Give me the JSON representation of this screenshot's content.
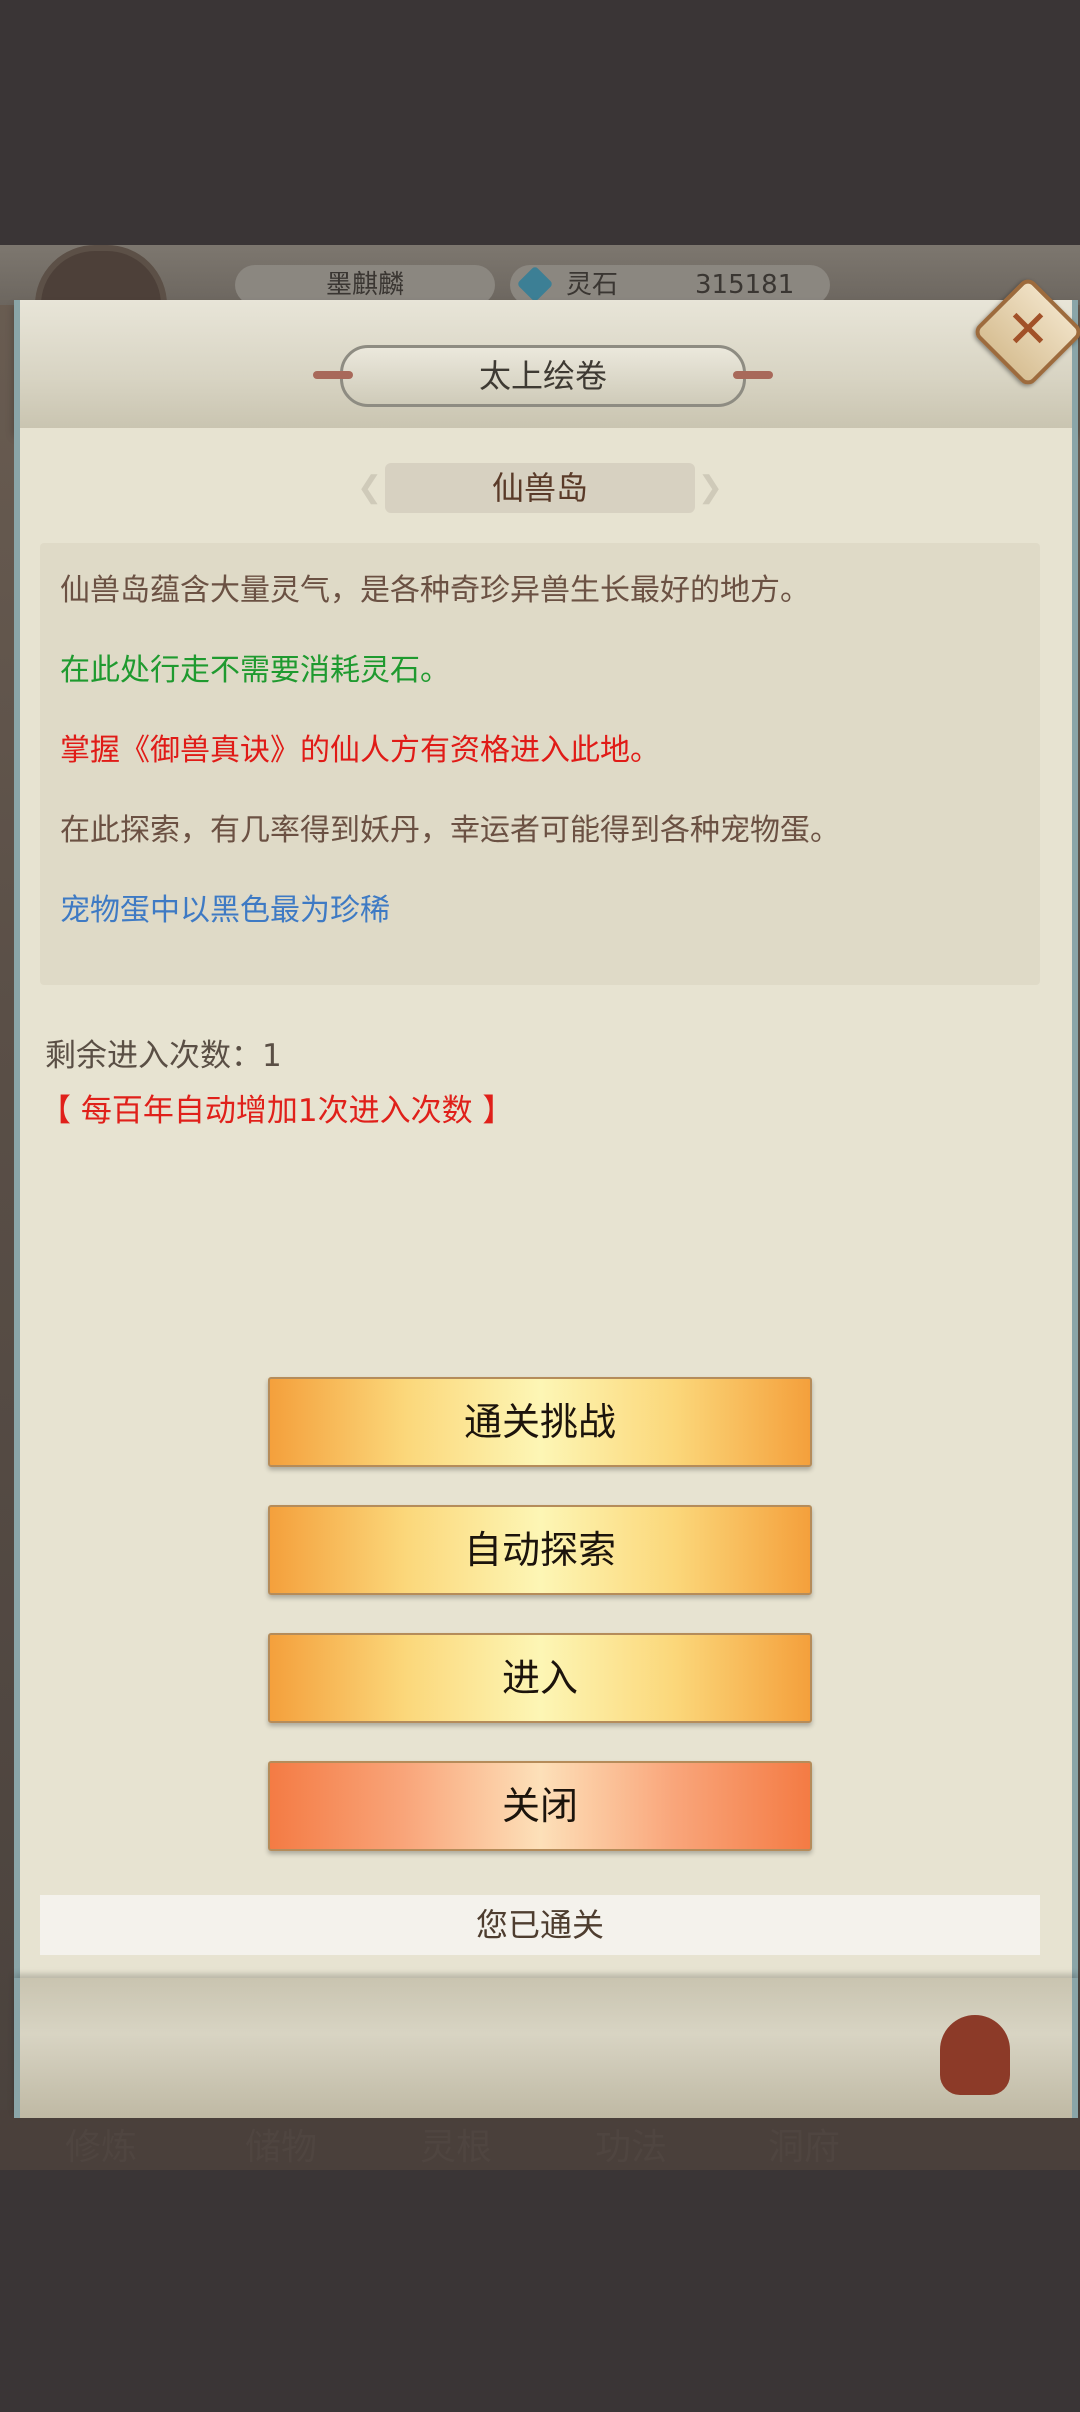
{
  "background": {
    "player_name": "墨麒麟",
    "currency_label": "灵石",
    "currency_value": "315181",
    "nav": [
      "修炼",
      "储物",
      "灵根",
      "功法",
      "洞府"
    ]
  },
  "dialog": {
    "title": "太上绘卷",
    "close_icon": "close-x-icon",
    "location_name": "仙兽岛",
    "descriptions": [
      {
        "text": "仙兽岛蕴含大量灵气，是各种奇珍异兽生长最好的地方。",
        "color": "#6b5143"
      },
      {
        "text": "在此处行走不需要消耗灵石。",
        "color": "#1f9a2f"
      },
      {
        "text": "掌握《御兽真诀》的仙人方有资格进入此地。",
        "color": "#e01b17"
      },
      {
        "text": "在此探索，有几率得到妖丹，幸运者可能得到各种宠物蛋。",
        "color": "#6b5143"
      },
      {
        "text": "宠物蛋中以黑色最为珍稀",
        "color": "#3e7ac4"
      }
    ],
    "remaining_label": "剩余进入次数：1",
    "auto_increase_note": "【 每百年自动增加1次进入次数 】",
    "buttons": {
      "challenge": "通关挑战",
      "auto_explore": "自动探索",
      "enter": "进入",
      "close": "关闭"
    },
    "status": "您已通关"
  }
}
